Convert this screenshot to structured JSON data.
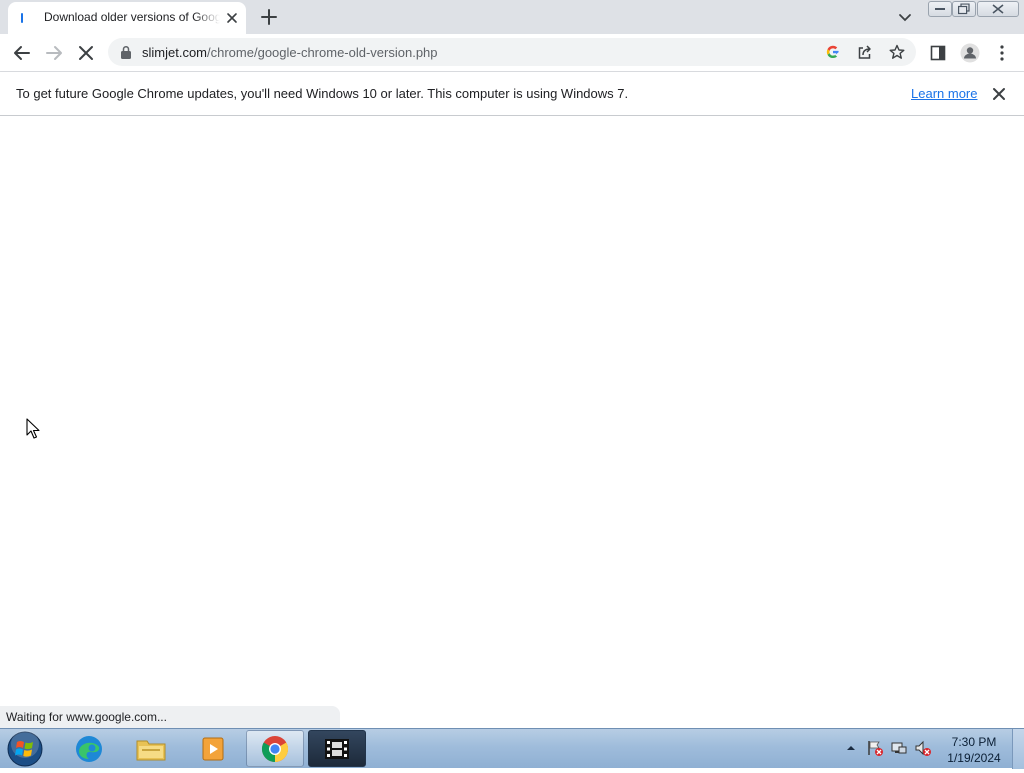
{
  "tab": {
    "title": "Download older versions of Google Chrome"
  },
  "toolbar": {
    "url_host": "slimjet.com",
    "url_path": "/chrome/google-chrome-old-version.php"
  },
  "infobar": {
    "message": "To get future Google Chrome updates, you'll need Windows 10 or later. This computer is using Windows 7.",
    "link_label": "Learn more"
  },
  "status": {
    "text": "Waiting for www.google.com..."
  },
  "taskbar": {
    "time": "7:30 PM",
    "date": "1/19/2024",
    "apps": [
      "edge-icon",
      "file-explorer-icon",
      "media-player-icon",
      "chrome-icon",
      "video-editor-icon"
    ]
  },
  "colors": {
    "tabstrip_bg": "#dee1e6",
    "link": "#1a73e8",
    "taskbar": "#9fbcdb"
  }
}
